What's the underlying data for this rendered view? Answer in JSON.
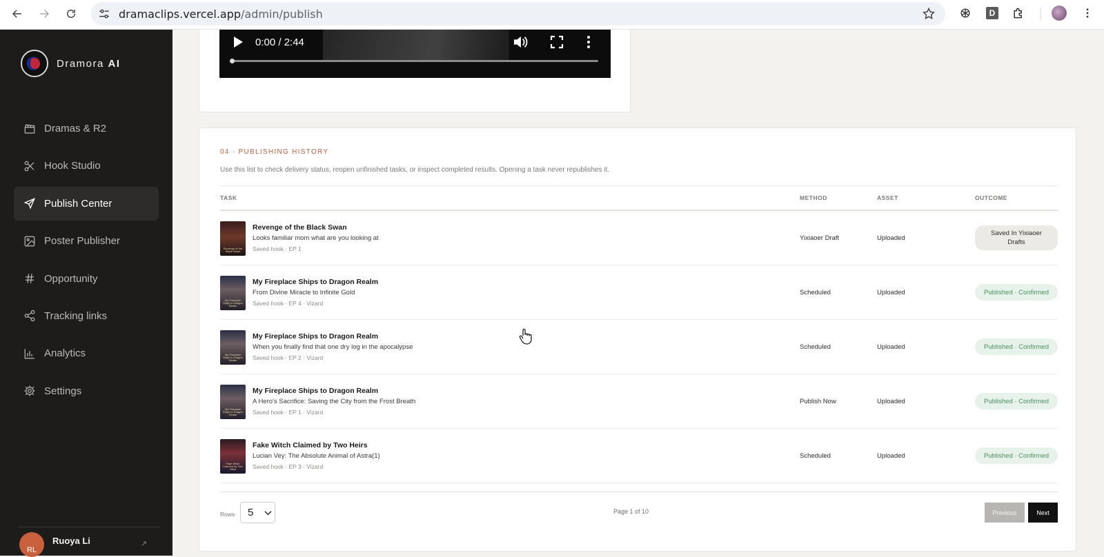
{
  "browser": {
    "url_host": "dramaclips.vercel.app",
    "url_path": "/admin/publish",
    "ext_d_label": "D"
  },
  "sidebar": {
    "brand_prefix": "Dramora",
    "brand_suffix": "AI",
    "items": [
      {
        "label": "Dramas & R2",
        "icon": "clapperboard-icon"
      },
      {
        "label": "Hook Studio",
        "icon": "scissors-icon"
      },
      {
        "label": "Publish Center",
        "icon": "send-icon"
      },
      {
        "label": "Poster Publisher",
        "icon": "image-icon"
      },
      {
        "label": "Opportunity",
        "icon": "hash-icon"
      },
      {
        "label": "Tracking links",
        "icon": "share-icon"
      },
      {
        "label": "Analytics",
        "icon": "bar-chart-icon"
      },
      {
        "label": "Settings",
        "icon": "gear-icon"
      }
    ],
    "active_index": 2,
    "user": {
      "initials": "RL",
      "name": "Ruoya Li",
      "link_glyph": "↗"
    }
  },
  "video": {
    "time": "0:00 / 2:44",
    "progress": 0.0
  },
  "history": {
    "section_label": "04 · PUBLISHING HISTORY",
    "description": "Use this list to check delivery status, reopen unfinished tasks, or inspect completed results. Opening a task never republishes it.",
    "columns": {
      "task": "TASK",
      "method": "METHOD",
      "asset": "ASSET",
      "outcome": "OUTCOME"
    },
    "rows": [
      {
        "title": "Revenge of the Black Swan",
        "subtitle": "Looks familiar mom what are you looking at",
        "meta": "Saved hook · EP 1",
        "method": "Yixiaoer Draft",
        "asset": "Uploaded",
        "outcome": "Saved In Yixiaoer Drafts",
        "outcome_style": "grey",
        "thumb_text": "Revenge of the Black Swan"
      },
      {
        "title": "My Fireplace Ships to Dragon Realm",
        "subtitle": "From Divine Miracle to Infinite Gold",
        "meta": "Saved hook · EP 4 · Vizard",
        "method": "Scheduled",
        "asset": "Uploaded",
        "outcome": "Published · Confirmed",
        "outcome_style": "green",
        "thumb_text": "My Fireplace Ships to Dragon Realm"
      },
      {
        "title": "My Fireplace Ships to Dragon Realm",
        "subtitle": "When you finally find that one dry log in the apocalypse",
        "meta": "Saved hook · EP 2 · Vizard",
        "method": "Scheduled",
        "asset": "Uploaded",
        "outcome": "Published · Confirmed",
        "outcome_style": "green",
        "thumb_text": "My Fireplace Ships to Dragon Realm"
      },
      {
        "title": "My Fireplace Ships to Dragon Realm",
        "subtitle": "A Hero's Sacrifice: Saving the City from the Frost Breath",
        "meta": "Saved hook · EP 1 · Vizard",
        "method": "Publish Now",
        "asset": "Uploaded",
        "outcome": "Published · Confirmed",
        "outcome_style": "green",
        "thumb_text": "My Fireplace Ships to Dragon Realm"
      },
      {
        "title": "Fake Witch Claimed by Two Heirs",
        "subtitle": "Lucian Vey: The Absolute Animal of Astra(1)",
        "meta": "Saved hook · EP 3 · Vizard",
        "method": "Scheduled",
        "asset": "Uploaded",
        "outcome": "Published · Confirmed",
        "outcome_style": "green",
        "thumb_text": "Fake Witch Claimed by Two Heirs"
      }
    ],
    "pagination": {
      "rows_label": "Rows",
      "rows_value": "5",
      "page_label": "Page 1 of 10",
      "previous_label": "Previous",
      "next_label": "Next"
    }
  },
  "colors": {
    "sidebar_bg": "#1d1c1b",
    "accent_label": "#b06246",
    "status_green": "#4b8f5c"
  }
}
